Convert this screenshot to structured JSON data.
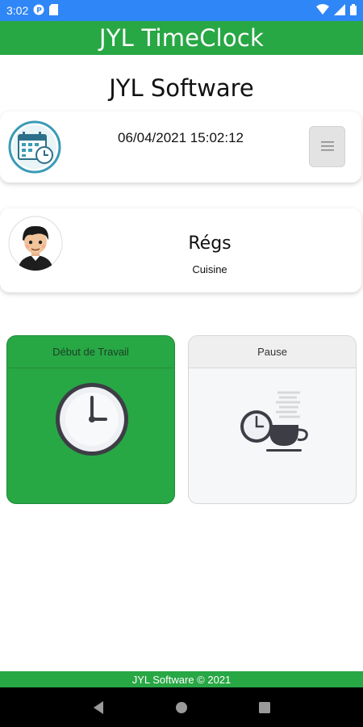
{
  "status_bar": {
    "time": "3:02",
    "left_icons": [
      "notification-p-icon",
      "sim-card-icon"
    ],
    "right_icons": [
      "wifi-icon",
      "signal-icon",
      "battery-icon"
    ]
  },
  "app_bar": {
    "title": "JYL TimeClock"
  },
  "company": {
    "name": "JYL Software"
  },
  "datetime_card": {
    "datetime": "06/04/2021 15:02:12",
    "icon": "calendar-clock-icon",
    "menu_icon": "hamburger-menu-icon"
  },
  "user_card": {
    "avatar": "user-avatar-icon",
    "name": "Régs",
    "department": "Cuisine"
  },
  "actions": {
    "start_work": {
      "label": "Début de Travail",
      "icon": "clock-icon"
    },
    "pause": {
      "label": "Pause",
      "icon": "coffee-clock-icon"
    }
  },
  "footer": {
    "text": "JYL Software © 2021"
  },
  "nav_bar": {
    "buttons": [
      "back-icon",
      "home-icon",
      "recents-icon"
    ]
  },
  "colors": {
    "status_bar": "#2f86f6",
    "brand_green": "#28a745",
    "calendar_teal": "#3a9bb5"
  }
}
